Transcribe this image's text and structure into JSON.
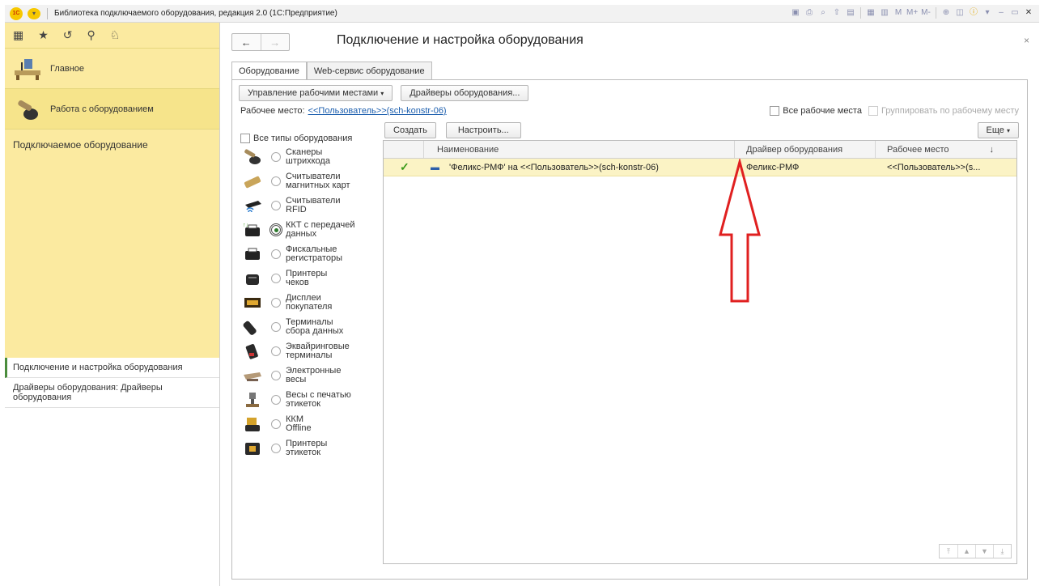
{
  "titlebar": {
    "logo": "1С",
    "title": "Библиотека подключаемого оборудования, редакция 2.0 (1С:Предприятие)",
    "m_label": "M",
    "mplus_label": "M+",
    "mminus_label": "M-"
  },
  "sidebar": {
    "sections": [
      {
        "label": "Главное"
      },
      {
        "label": "Работа с оборудованием"
      }
    ],
    "subhead": "Подключаемое оборудование",
    "nav_items": [
      {
        "label": "Подключение и настройка оборудования"
      },
      {
        "label": "Драйверы оборудования: Драйверы оборудования"
      }
    ]
  },
  "form": {
    "title": "Подключение и настройка оборудования",
    "back": "←",
    "forward": "→",
    "close": "×",
    "tabs": [
      {
        "label": "Оборудование"
      },
      {
        "label": "Web-сервис оборудование"
      }
    ],
    "workplaces_btn": "Управление рабочими местами",
    "drivers_btn": "Драйверы оборудования...",
    "workplace_label": "Рабочее место:",
    "workplace_value": "<<Пользователь>>(sch-konstr-06)",
    "all_workplaces": "Все рабочие места",
    "group_by_workplace": "Группировать по рабочему месту",
    "all_types": "Все типы оборудования",
    "types": [
      {
        "label": "Сканеры штрихкода"
      },
      {
        "label": "Считыватели магнитных карт"
      },
      {
        "label": "Считыватели RFID"
      },
      {
        "label": "ККТ с передачей данных"
      },
      {
        "label": "Фискальные регистраторы"
      },
      {
        "label": "Принтеры чеков"
      },
      {
        "label": "Дисплеи покупателя"
      },
      {
        "label": "Терминалы сбора данных"
      },
      {
        "label": "Эквайринговые терминалы"
      },
      {
        "label": "Электронные весы"
      },
      {
        "label": "Весы с печатью этикеток"
      },
      {
        "label": "ККМ Offline"
      },
      {
        "label": "Принтеры этикеток"
      }
    ],
    "selected_type_index": 3,
    "create_btn": "Создать",
    "configure_btn": "Настроить...",
    "more_btn": "Еще",
    "columns": {
      "name": "Наименование",
      "driver": "Драйвер оборудования",
      "workplace": "Рабочее место",
      "sort": "↓"
    },
    "rows": [
      {
        "name": "'Феликс-РМФ' на <<Пользователь>>(sch-konstr-06)",
        "driver": "Феликс-РМФ",
        "workplace": "<<Пользователь>>(s..."
      }
    ]
  },
  "colors": {
    "sidebar_bg": "#fbeaa0",
    "row_highlight": "#fbf3c5",
    "link": "#1d5fae",
    "arrow": "#e02020",
    "check": "#3a9a1a"
  }
}
